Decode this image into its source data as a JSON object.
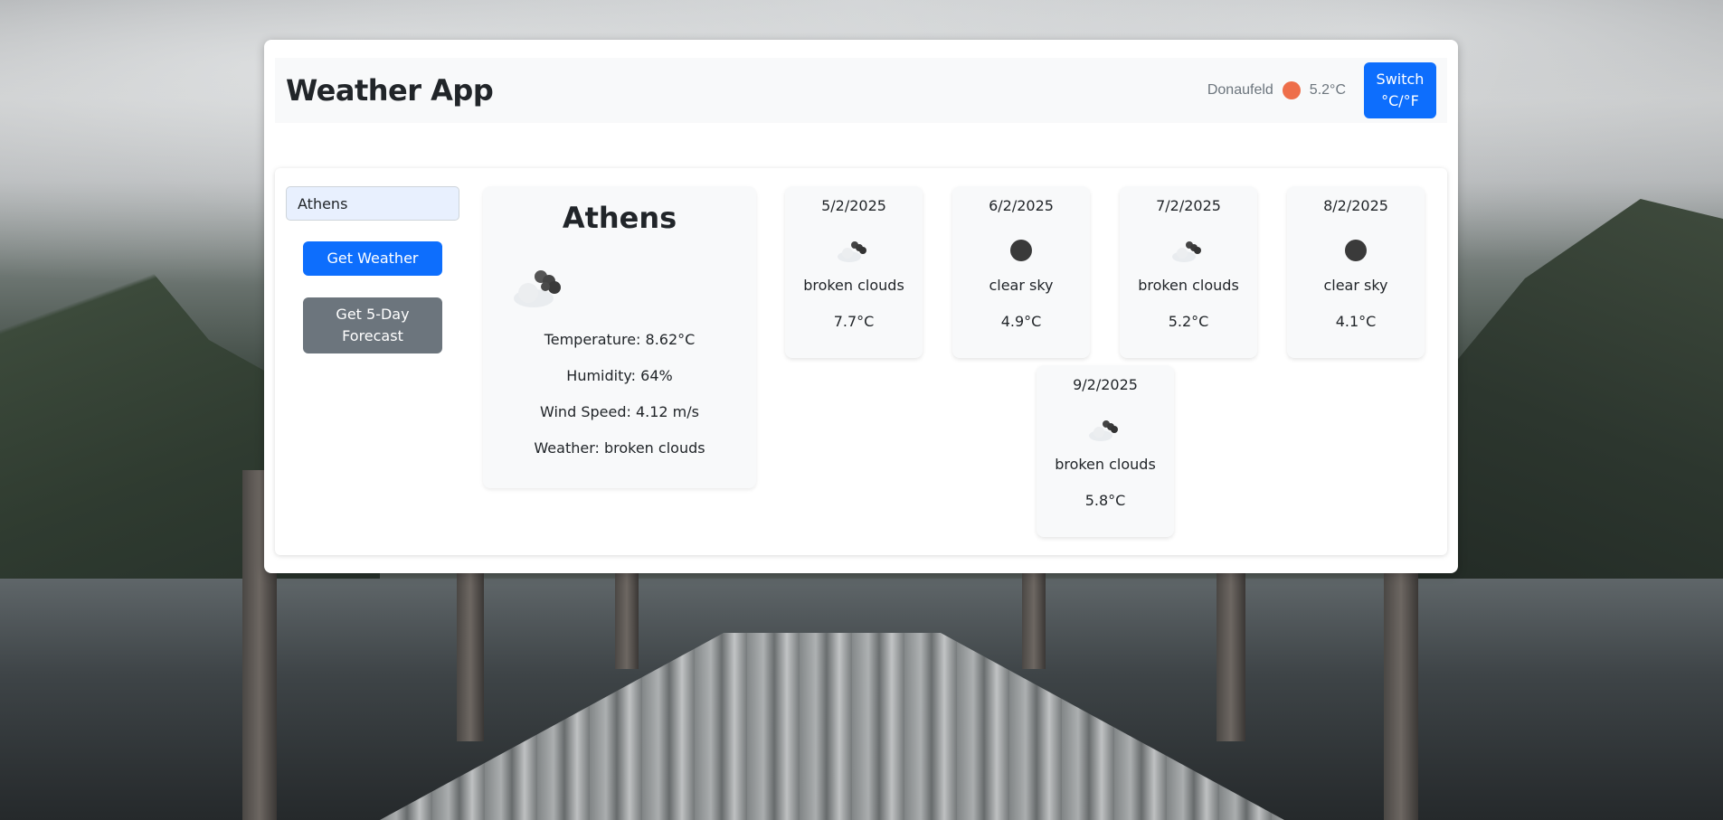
{
  "header": {
    "title": "Weather App",
    "location": "Donaufeld",
    "location_temp": "5.2°C",
    "switch_label_line1": "Switch",
    "switch_label_line2": "°C/°F"
  },
  "controls": {
    "city_value": "Athens",
    "get_weather_label": "Get Weather",
    "forecast_label_line1": "Get 5-Day",
    "forecast_label_line2": "Forecast"
  },
  "current": {
    "city": "Athens",
    "icon": "broken-clouds-icon",
    "temperature": "Temperature: 8.62°C",
    "humidity": "Humidity: 64%",
    "wind": "Wind Speed: 4.12 m/s",
    "weather": "Weather: broken clouds"
  },
  "forecast": [
    {
      "date": "5/2/2025",
      "icon": "broken-clouds-icon",
      "desc": "broken clouds",
      "temp": "7.7°C"
    },
    {
      "date": "6/2/2025",
      "icon": "clear-sky-icon",
      "desc": "clear sky",
      "temp": "4.9°C"
    },
    {
      "date": "7/2/2025",
      "icon": "broken-clouds-icon",
      "desc": "broken clouds",
      "temp": "5.2°C"
    },
    {
      "date": "8/2/2025",
      "icon": "clear-sky-icon",
      "desc": "clear sky",
      "temp": "4.1°C"
    },
    {
      "date": "9/2/2025",
      "icon": "broken-clouds-icon",
      "desc": "broken clouds",
      "temp": "5.8°C"
    }
  ],
  "colors": {
    "primary": "#0d6efd",
    "secondary": "#6c757d",
    "sun": "#ee6e4a",
    "card_bg": "#f8f9fa"
  }
}
